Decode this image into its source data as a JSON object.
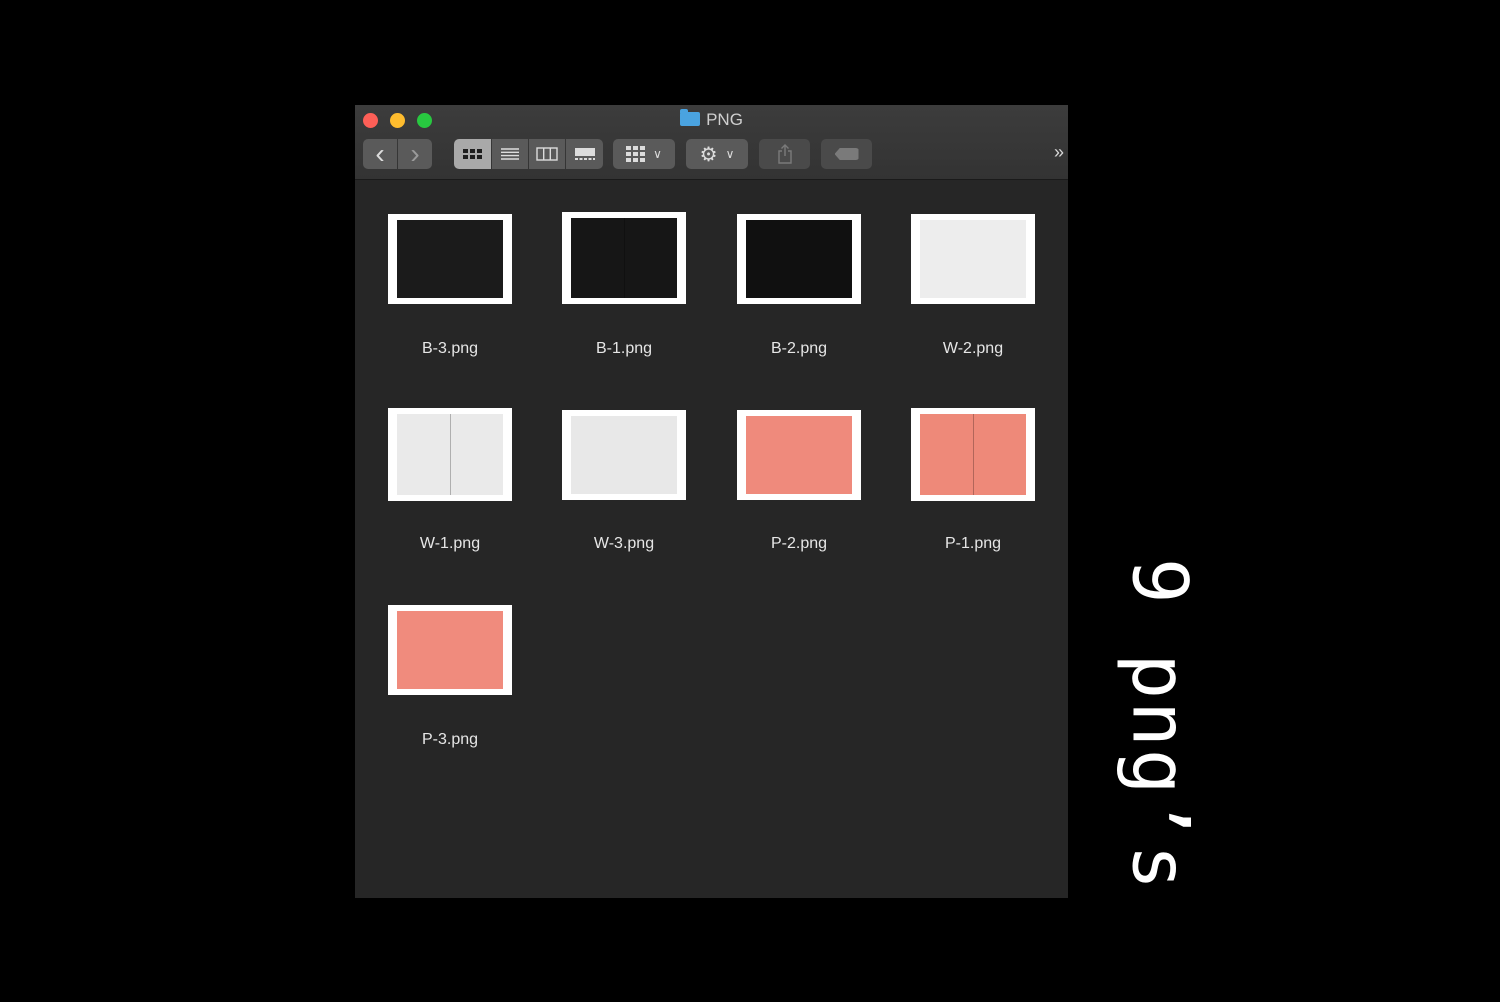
{
  "window": {
    "title": "PNG",
    "toolbar": {
      "back_icon": "‹",
      "forward_icon": "›",
      "more_icon": "»"
    }
  },
  "files": [
    {
      "name": "B-3.png",
      "color": "#1b1b1b",
      "spread": false
    },
    {
      "name": "B-1.png",
      "color": "#161616",
      "spread": true
    },
    {
      "name": "B-2.png",
      "color": "#101010",
      "spread": false
    },
    {
      "name": "W-2.png",
      "color": "#ededed",
      "spread": false
    },
    {
      "name": "W-1.png",
      "color": "#eaeaea",
      "spread": true
    },
    {
      "name": "W-3.png",
      "color": "#e8e8e8",
      "spread": false
    },
    {
      "name": "P-2.png",
      "color": "#ef8a7c",
      "spread": false
    },
    {
      "name": "P-1.png",
      "color": "#ee8979",
      "spread": true
    },
    {
      "name": "P-3.png",
      "color": "#f08b7d",
      "spread": false
    }
  ],
  "caption": "9 png’s",
  "colors": {
    "window_bg": "#262626",
    "close": "#fd5f57",
    "minimize": "#febc2e",
    "zoom": "#28c840",
    "folder": "#4aa3e0"
  }
}
